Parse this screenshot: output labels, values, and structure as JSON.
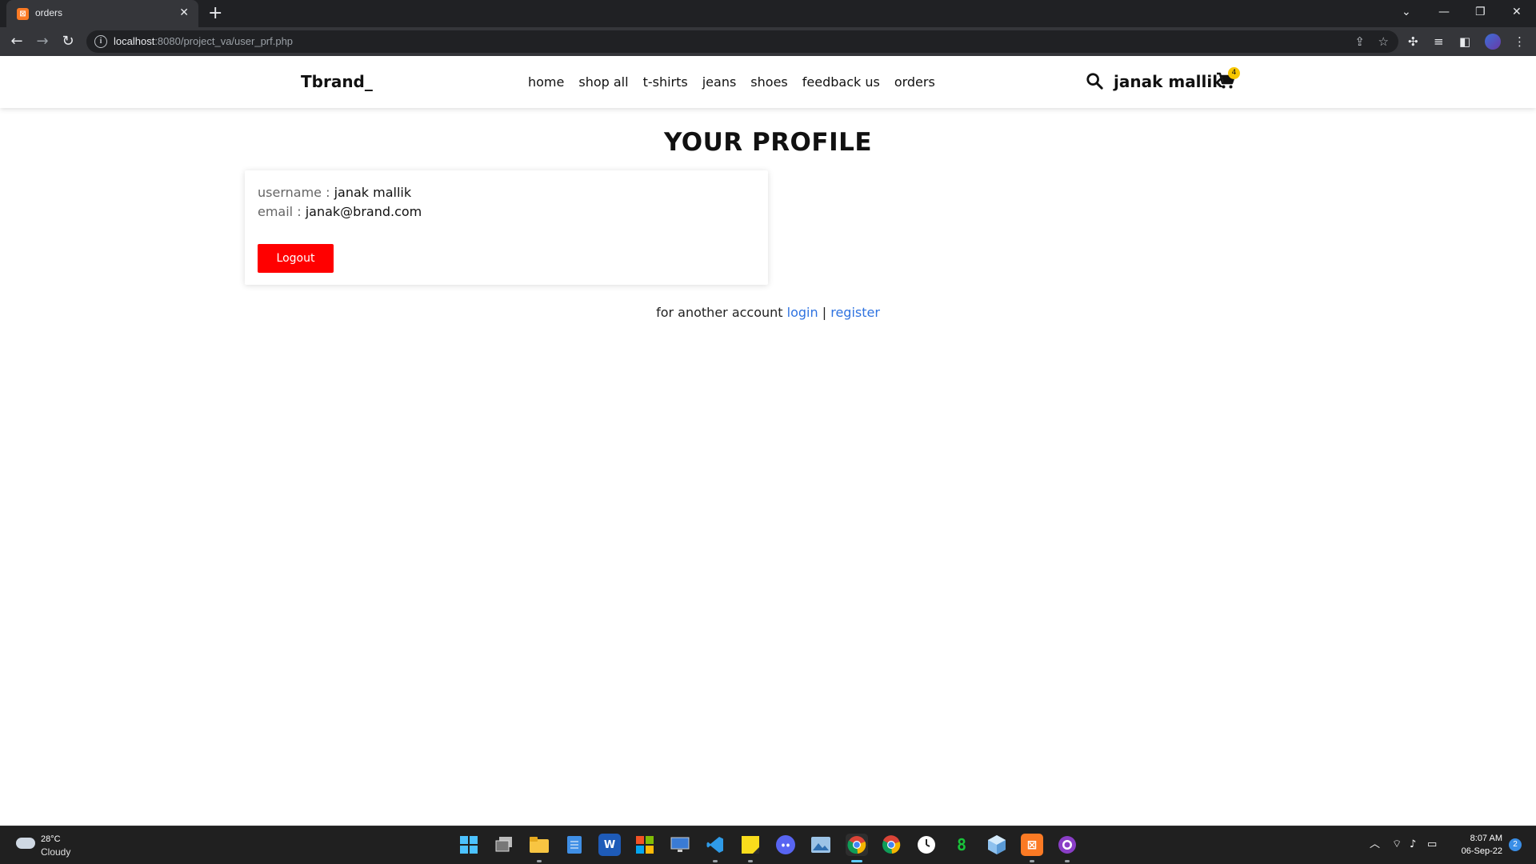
{
  "browser": {
    "tab_title": "orders",
    "tab_favicon": "xampp-icon",
    "url_host": "localhost",
    "url_rest": ":8080/project_va/user_prf.php",
    "new_tab_label": "+",
    "close_tab_label": "✕"
  },
  "site": {
    "logo": "Tbrand_",
    "nav": [
      "home",
      "shop all",
      "t-shirts",
      "jeans",
      "shoes",
      "feedback us",
      "orders"
    ],
    "user_name": "janak mallik",
    "cart_count": "4",
    "accent_color": "#ff0000",
    "link_color": "#2f73e0",
    "badge_color": "#f7c600"
  },
  "profile": {
    "title": "YOUR PROFILE",
    "username_label": "username :",
    "username_value": "janak mallik",
    "email_label": "email :",
    "email_value": "janak@brand.com",
    "logout_label": "Logout",
    "another_text": "for another account",
    "login_label": "login",
    "separator": "|",
    "register_label": "register"
  },
  "taskbar": {
    "temperature": "28°C",
    "weather": "Cloudy",
    "time": "8:07 AM",
    "date": "06-Sep-22",
    "notification_count": "2"
  }
}
